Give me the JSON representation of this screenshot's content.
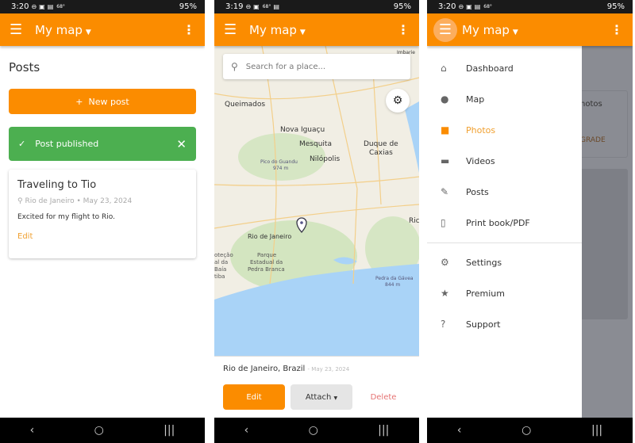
{
  "status": {
    "p1_time": "3:20",
    "p2_time": "3:19",
    "p3_time": "3:20",
    "temp": "68°",
    "battery": "95%"
  },
  "appbar": {
    "title": "My map"
  },
  "posts": {
    "heading": "Posts",
    "new_post": "New post",
    "snackbar": "Post published",
    "card": {
      "title": "Traveling to Tio",
      "location": "Rio de Janeiro",
      "date": "May 23, 2024",
      "body": "Excited for my flight to Rio.",
      "edit": "Edit"
    }
  },
  "map": {
    "search_placeholder": "Search for a place...",
    "labels": [
      "Imbarie",
      "Queimados",
      "Nova Iguaçu",
      "Mesquita",
      "Nilópolis",
      "Duque de",
      "Caxias",
      "Pico do Guandu",
      "974 m",
      "Rio de Janeiro",
      "Ric",
      "Parque",
      "Estadual da",
      "Pedra Branca",
      "oteção",
      "al da",
      "Baía",
      "tiba",
      "Pedra da Gávea",
      "844 m"
    ],
    "sheet": {
      "place": "Rio de Janeiro, Brazil",
      "date": "May 23, 2024",
      "edit": "Edit",
      "attach": "Attach",
      "delete": "Delete"
    }
  },
  "drawer": {
    "items": [
      {
        "label": "Dashboard",
        "icon": "home-icon"
      },
      {
        "label": "Map",
        "icon": "map-pin-icon"
      },
      {
        "label": "Photos",
        "icon": "image-icon",
        "active": true
      },
      {
        "label": "Videos",
        "icon": "video-icon"
      },
      {
        "label": "Posts",
        "icon": "pencil-icon"
      },
      {
        "label": "Print book/PDF",
        "icon": "book-icon"
      }
    ],
    "secondary": [
      {
        "label": "Settings",
        "icon": "gear-icon"
      },
      {
        "label": "Premium",
        "icon": "star-icon"
      },
      {
        "label": "Support",
        "icon": "help-icon"
      }
    ],
    "behind": {
      "photos": "hotos",
      "upgrade": "GRADE"
    }
  },
  "colors": {
    "accent": "#fb8c00",
    "success": "#4caf50",
    "delete": "#e57373"
  }
}
